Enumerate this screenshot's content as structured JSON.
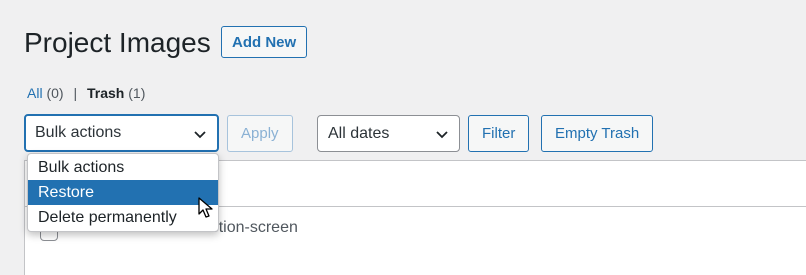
{
  "header": {
    "title": "Project Images",
    "add_new_label": "Add New"
  },
  "views": {
    "all_label": "All",
    "all_count": "(0)",
    "separator": "|",
    "trash_label": "Trash",
    "trash_count": "(1)"
  },
  "bulk_actions": {
    "selected": "Bulk actions",
    "options": [
      "Bulk actions",
      "Restore",
      "Delete permanently"
    ],
    "highlighted": "Restore",
    "apply_label": "Apply"
  },
  "filters": {
    "dates_selected": "All dates",
    "filter_label": "Filter",
    "empty_trash_label": "Empty Trash"
  },
  "table": {
    "rows": [
      {
        "title": "restore-trashed-section-screen"
      }
    ]
  },
  "colors": {
    "accent": "#2271b1",
    "background": "#f0f0f1",
    "highlight": "#2271b1"
  }
}
